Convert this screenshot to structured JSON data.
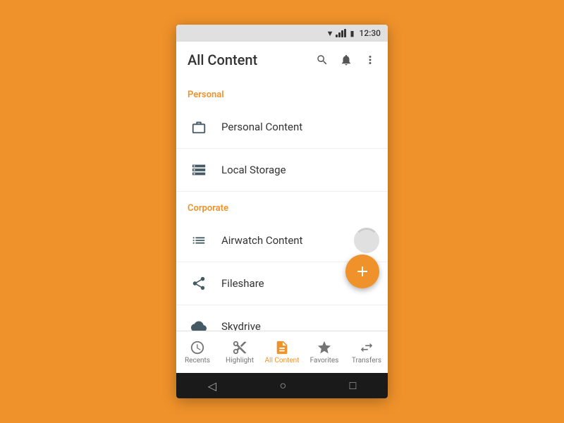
{
  "statusBar": {
    "time": "12:30"
  },
  "appBar": {
    "title": "All Content",
    "searchLabel": "search",
    "notificationLabel": "notifications",
    "moreLabel": "more options"
  },
  "sections": [
    {
      "id": "personal",
      "header": "Personal",
      "items": [
        {
          "id": "personal-content",
          "label": "Personal Content",
          "icon": "briefcase"
        },
        {
          "id": "local-storage",
          "label": "Local Storage",
          "icon": "server"
        }
      ]
    },
    {
      "id": "corporate",
      "header": "Corporate",
      "items": [
        {
          "id": "airwatch-content",
          "label": "Airwatch Content",
          "icon": "list",
          "loading": true
        },
        {
          "id": "fileshare",
          "label": "Fileshare",
          "icon": "share"
        },
        {
          "id": "skydrive",
          "label": "Skydrive",
          "icon": "cloud"
        }
      ]
    }
  ],
  "fab": {
    "label": "+"
  },
  "bottomNav": [
    {
      "id": "recents",
      "label": "Recents",
      "icon": "clock",
      "active": false
    },
    {
      "id": "highlight",
      "label": "Highlight",
      "icon": "scissors",
      "active": false
    },
    {
      "id": "all-content",
      "label": "All Content",
      "icon": "file",
      "active": true
    },
    {
      "id": "favorites",
      "label": "Favorites",
      "icon": "star",
      "active": false
    },
    {
      "id": "transfers",
      "label": "Transfers",
      "icon": "transfer",
      "active": false
    }
  ],
  "androidNav": {
    "back": "◁",
    "home": "○",
    "recents": "□"
  }
}
